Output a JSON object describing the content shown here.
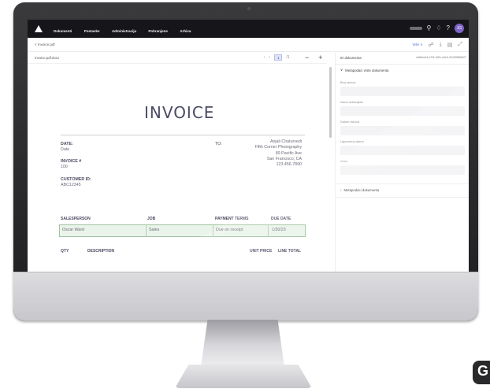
{
  "nav": {
    "items": [
      "Dokumenti",
      "Postavke",
      "Administracija",
      "Pohranjene",
      "Arhiva"
    ]
  },
  "subbar": {
    "back_label": "< Invoice.pdf",
    "more_label": "Više ∨"
  },
  "viewer": {
    "doc_name": "Invoice.pdf.docx",
    "current_page": "1",
    "page_total": "/1"
  },
  "invoice": {
    "title": "INVOICE",
    "date_label": "DATE:",
    "date_value": "Date",
    "invoice_no_label": "INVOICE #",
    "invoice_no_value": "100",
    "customer_id_label": "CUSTOMER ID:",
    "customer_id_value": "ABC12345",
    "to_label": "TO:",
    "to_lines": [
      "Anjali Chaturvedi",
      "Fifth Corner Photography",
      "89 Pacific Ave",
      "San Francisco, CA",
      "123.456.7890"
    ],
    "table1_headers": [
      "SALESPERSON",
      "JOB",
      "PAYMENT TERMS",
      "DUE DATE"
    ],
    "table1_row": [
      "Oscar Ward",
      "Sales",
      "Due on receipt",
      "1/30/23"
    ],
    "table2_headers": [
      "QTY",
      "DESCRIPTION",
      "UNIT PRICE",
      "LINE TOTAL"
    ]
  },
  "panel": {
    "title": "ID dokumenta",
    "doc_id": "d4f8ee04-e7f3-4f2b-a2e9-2f1305f68627",
    "section_open": "Metapodaci vrste dokumenta",
    "fields": [
      "Broj računa",
      "Naziv dobavljača",
      "Datum računa",
      "Ugovorena cijena",
      "Vrsta"
    ],
    "section_closed": "Metapodaci dokumenta"
  },
  "colors": {
    "topbar": "#16161a",
    "accent": "#4b6cd6",
    "avatar": "#7d63c7",
    "highlight_row": "#eaf4ea",
    "invoice_text": "#4a4a63"
  },
  "icons": [
    "apps-logo-icon",
    "search-icon",
    "bell-icon",
    "help-icon",
    "share-icon",
    "download-icon",
    "print-icon",
    "expand-icon",
    "zoom-out-icon",
    "zoom-in-icon",
    "chevron-left-icon",
    "chevron-right-icon"
  ]
}
